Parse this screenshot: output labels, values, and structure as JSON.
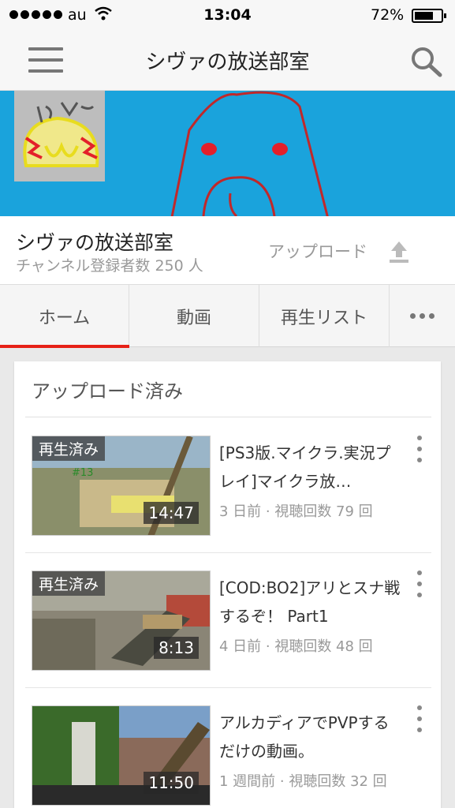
{
  "status_bar": {
    "carrier": "au",
    "time": "13:04",
    "battery": "72%",
    "battery_level": 0.72
  },
  "app_bar": {
    "title": "シヴァの放送部室",
    "menu_icon": "hamburger-menu-icon",
    "search_icon": "search-icon"
  },
  "channel": {
    "banner_color": "#1aa3dc",
    "name": "シヴァの放送部室",
    "subscribers": "チャンネル登録者数 250 人",
    "upload_label": "アップロード",
    "upload_icon": "upload-icon"
  },
  "tabs": [
    {
      "label": "ホーム",
      "active": true
    },
    {
      "label": "動画",
      "active": false
    },
    {
      "label": "再生リスト",
      "active": false
    },
    {
      "label": "",
      "icon": "more-icon"
    }
  ],
  "uploaded": {
    "section_title": "アップロード済み",
    "videos": [
      {
        "watched_badge": "再生済み",
        "duration": "14:47",
        "title": "[PS3版.マイクラ.実況プレイ]マイクラ放…",
        "meta": "3 日前 · 視聴回数 79 回"
      },
      {
        "watched_badge": "再生済み",
        "duration": "8:13",
        "title": "[COD:BO2]アリとスナ戦するぞ！ Part1",
        "meta": "4 日前 · 視聴回数 48 回"
      },
      {
        "watched_badge": "",
        "duration": "11:50",
        "title": "アルカディアでPVPするだけの動画。",
        "meta": "1 週間前 · 視聴回数 32 回"
      }
    ]
  },
  "colors": {
    "accent": "#e62117",
    "banner": "#1aa3dc"
  }
}
